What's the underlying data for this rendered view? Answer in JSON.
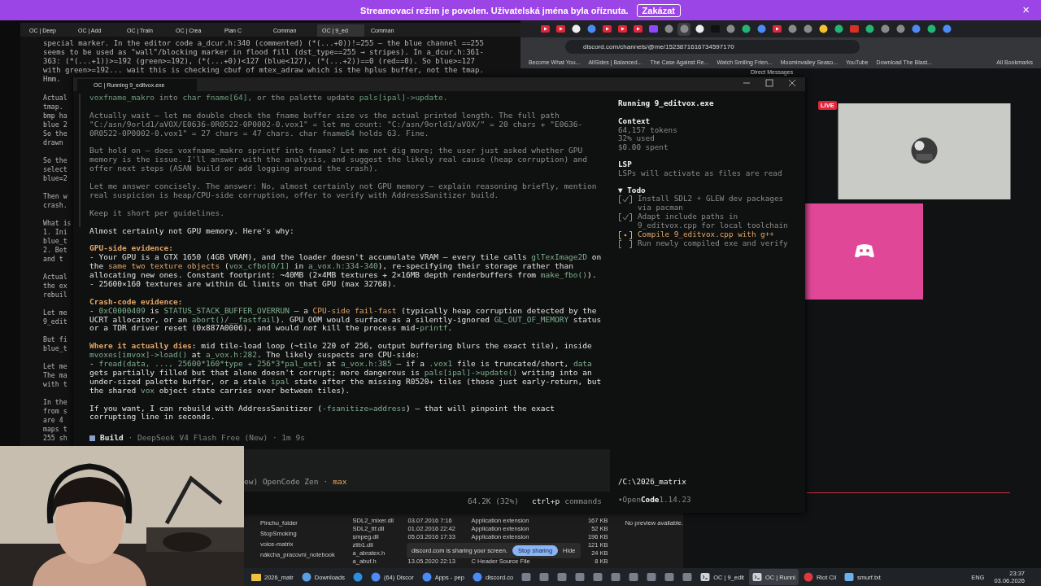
{
  "banner": {
    "text": "Streamovací režim je povolen. Uživatelská jména byla oříznuta.",
    "button": "Zakázat",
    "close": "×"
  },
  "background_terminal": {
    "tabs": [
      {
        "label": "OC | Deep",
        "selected": false
      },
      {
        "label": "OC | Add",
        "selected": false
      },
      {
        "label": "OC | Train",
        "selected": false
      },
      {
        "label": "OC | Crea",
        "selected": false
      },
      {
        "label": "Plan C",
        "selected": false
      },
      {
        "label": "Comman",
        "selected": false
      },
      {
        "label": "OC | 9_ed",
        "selected": true
      },
      {
        "label": "Comman",
        "selected": false
      }
    ],
    "lines": [
      "special marker. In the editor code a_dcur.h:340 (commented) (*(...+0))!=255 — the blue channel ==255",
      "seems to be used as \"wall\"/blocking marker in flood fill (dst_type==255 → stripes). In a_dcur.h:361-",
      "363: (*(...+1))>=192 (green>=192), (*(...+0))<127 (blue<127), (*(...+2))==0 (red==0). So blue>=127",
      "with green>=192... wait this is checking cbuf of mtex_adraw which is the hplus buffer, not the tmap.",
      "Hmm."
    ],
    "fragments": [
      [
        "Actual",
        "tmap.",
        "bmp ha",
        "blue 2",
        "So the",
        "drawn"
      ],
      [
        "So the",
        "select",
        "blue=2"
      ],
      [
        "Then w",
        "crash."
      ],
      [
        "What is",
        "1. Ini",
        "blue_t",
        "2. Bet",
        "and t"
      ],
      [
        "Actual",
        "the ex",
        "rebuil"
      ],
      [
        "Let me",
        "9_edit"
      ],
      [
        "But fi",
        "blue_t"
      ],
      [
        "Let me",
        "The ma",
        "with t"
      ],
      [
        "In the",
        "from s",
        "are 4",
        "maps t",
        "255 sh"
      ]
    ]
  },
  "browser": {
    "tabs": [
      {
        "kind": "video",
        "selected": false
      },
      {
        "kind": "video",
        "selected": false
      },
      {
        "kind": "github",
        "selected": false
      },
      {
        "kind": "chrome",
        "selected": false
      },
      {
        "kind": "video",
        "selected": false
      },
      {
        "kind": "video",
        "selected": false
      },
      {
        "kind": "video",
        "selected": false
      },
      {
        "kind": "twitch",
        "selected": false
      },
      {
        "kind": "generic",
        "selected": false
      },
      {
        "kind": "generic",
        "selected": true
      },
      {
        "kind": "github",
        "selected": false
      },
      {
        "kind": "x",
        "selected": false
      },
      {
        "kind": "generic",
        "selected": false
      },
      {
        "kind": "green",
        "selected": false
      },
      {
        "kind": "chrome",
        "selected": false
      },
      {
        "kind": "video",
        "selected": false
      },
      {
        "kind": "generic",
        "selected": false
      },
      {
        "kind": "generic",
        "selected": false
      },
      {
        "kind": "yellow",
        "selected": false
      },
      {
        "kind": "green",
        "selected": false
      },
      {
        "kind": "mail",
        "selected": false
      },
      {
        "kind": "green",
        "selected": false
      },
      {
        "kind": "generic",
        "selected": false
      },
      {
        "kind": "generic",
        "selected": false
      },
      {
        "kind": "chrome",
        "selected": false
      },
      {
        "kind": "green",
        "selected": false
      },
      {
        "kind": "chrome",
        "selected": false
      }
    ],
    "address": "discord.com/channels/@me/1523871616734597170",
    "bookmarks": [
      "Become What You...",
      "AllSides | Balanced...",
      "The Case Against Re...",
      "Watch Smiling Frien...",
      "Moominvalley Seaso...",
      "YouTube",
      "Download The Blast..."
    ],
    "all_bookmarks": "All Bookmarks",
    "discord": {
      "header": "Direct Messages",
      "live_badge": "LIVE"
    }
  },
  "explorer": {
    "folders": [
      "Pinchu_folder",
      "StopSmoking",
      "voice-matrix",
      "nákcha_pracovni_notebook"
    ],
    "files": [
      {
        "name": "SDL2_mixer.dll",
        "date": "03.07.2016 7:16",
        "type": "Application extension",
        "size": "167 KB"
      },
      {
        "name": "SDL2_ttf.dll",
        "date": "01.02.2016 22:42",
        "type": "Application extension",
        "size": "52 KB"
      },
      {
        "name": "smpeg.dll",
        "date": "05.03.2016 17:33",
        "type": "Application extension",
        "size": "196 KB"
      },
      {
        "name": "zlib1.dll",
        "size": "121 KB"
      },
      {
        "name": "a_abratex.h",
        "size": "24 KB"
      },
      {
        "name": "a_abuf.h",
        "date": "13.05.2020 22:13",
        "type": "C Header Source File",
        "size": "8 KB"
      }
    ],
    "preview": "No preview available.",
    "share_popup": {
      "text": "discord.com is sharing your screen.",
      "stop": "Stop sharing",
      "hide": "Hide"
    }
  },
  "opencode": {
    "tab": "OC | Running 9_editvox.exe",
    "paragraphs": [
      {
        "kind": "thought",
        "lines": [
          [
            {
              "kind": "code",
              "t": "voxfname_makro"
            },
            {
              "kind": "plain",
              "t": " into "
            },
            {
              "kind": "code",
              "t": "char fname[64]"
            },
            {
              "kind": "plain",
              "t": ", or the palette update "
            },
            {
              "kind": "code",
              "t": "pals[ipal]->update"
            },
            {
              "kind": "plain",
              "t": "."
            }
          ]
        ]
      },
      {
        "kind": "thought",
        "lines": [
          [
            {
              "kind": "plain",
              "t": "Actually wait — let me double check the fname buffer size vs the actual printed length. The full path \"C:/asn/9orld1/aVOX/E0636-0R0522-0P0002-0.vox1\" = let me count: \"C:/asn/9orld1/aVOX/\" = 20 chars + \"E0636-0R0522-0P0002-0.vox1\" = 27 chars = 47 chars. char fname"
            },
            {
              "kind": "code",
              "t": "64"
            },
            {
              "kind": "plain",
              "t": " holds 63. Fine."
            }
          ]
        ]
      },
      {
        "kind": "thought",
        "lines": [
          [
            {
              "kind": "plain",
              "t": "But hold on — does voxfname_makro sprintf into fname? Let me not dig more; the user just asked whether GPU memory is the issue. I'll answer with the analysis, and suggest the likely real cause (heap corruption) and offer next steps (ASAN build or add logging around the crash)."
            }
          ]
        ]
      },
      {
        "kind": "thought",
        "lines": [
          [
            {
              "kind": "plain",
              "t": "Let me answer concisely. The answer: No, almost certainly not GPU memory — explain reasoning briefly, mention real suspicion is heap/CPU-side corruption, offer to verify with AddressSanitizer build."
            }
          ]
        ]
      },
      {
        "kind": "thought",
        "lines": [
          [
            {
              "kind": "plain",
              "t": "Keep it short per guidelines."
            }
          ]
        ]
      },
      {
        "kind": "answer",
        "lines": [
          [
            {
              "kind": "plain",
              "t": "Almost certainly not GPU memory. Here's why:"
            }
          ]
        ]
      },
      {
        "kind": "answer",
        "lines": [
          [
            {
              "kind": "heading",
              "t": "GPU-side evidence:"
            }
          ],
          [
            {
              "kind": "plain",
              "t": "- Your GPU is a GTX 1650 (4GB VRAM), and the loader doesn't accumulate VRAM — every tile calls "
            },
            {
              "kind": "code",
              "t": "glTexImage2D"
            },
            {
              "kind": "plain",
              "t": " on the "
            },
            {
              "kind": "accent",
              "t": "same two texture objects"
            },
            {
              "kind": "plain",
              "t": " ("
            },
            {
              "kind": "code",
              "t": "vox_cfbo[0/1]"
            },
            {
              "kind": "plain",
              "t": " in "
            },
            {
              "kind": "code",
              "t": "a_vox.h:334-340"
            },
            {
              "kind": "plain",
              "t": "), re-specifying their storage rather than allocating new ones. Constant footprint: ~40MB (2×4MB textures + 2×16MB depth renderbuffers from "
            },
            {
              "kind": "code",
              "t": "make_fbo()"
            },
            {
              "kind": "plain",
              "t": ")."
            }
          ],
          [
            {
              "kind": "plain",
              "t": "- 25600×160 textures are within GL limits on that GPU (max 32768)."
            }
          ]
        ]
      },
      {
        "kind": "answer",
        "lines": [
          [
            {
              "kind": "heading",
              "t": "Crash-code evidence:"
            }
          ],
          [
            {
              "kind": "plain",
              "t": "- "
            },
            {
              "kind": "code",
              "t": "0xC0000409"
            },
            {
              "kind": "plain",
              "t": " is "
            },
            {
              "kind": "code",
              "t": "STATUS_STACK_BUFFER_OVERRUN"
            },
            {
              "kind": "plain",
              "t": " — a "
            },
            {
              "kind": "accent",
              "t": "CPU-side fail-fast"
            },
            {
              "kind": "plain",
              "t": " (typically heap corruption detected by the UCRT allocator, or an "
            },
            {
              "kind": "code",
              "t": "abort()/__fastfail"
            },
            {
              "kind": "plain",
              "t": "). GPU OOM would surface as a silently-ignored "
            },
            {
              "kind": "code",
              "t": "GL_OUT_OF_MEMORY"
            },
            {
              "kind": "plain",
              "t": " status or a TDR driver reset (0x887A0006), and would "
            },
            {
              "kind": "italic",
              "t": "not"
            },
            {
              "kind": "plain",
              "t": " kill the process mid-"
            },
            {
              "kind": "code",
              "t": "printf"
            },
            {
              "kind": "plain",
              "t": "."
            }
          ]
        ]
      },
      {
        "kind": "answer",
        "lines": [
          [
            {
              "kind": "heading",
              "t": "Where it actually dies:"
            },
            {
              "kind": "plain",
              "t": " mid tile-load loop (~tile 220 of 256, output buffering blurs the exact tile), inside "
            },
            {
              "kind": "code",
              "t": "mvoxes[imvox]->load()"
            },
            {
              "kind": "plain",
              "t": " at "
            },
            {
              "kind": "code",
              "t": "a_vox.h:282"
            },
            {
              "kind": "plain",
              "t": ". The likely suspects are CPU-side:"
            }
          ],
          [
            {
              "kind": "plain",
              "t": "- "
            },
            {
              "kind": "code",
              "t": "fread(data, ..., 25600*160*type + 256*3*pal_ext)"
            },
            {
              "kind": "plain",
              "t": " at "
            },
            {
              "kind": "code",
              "t": "a_vox.h:385"
            },
            {
              "kind": "plain",
              "t": " — if a "
            },
            {
              "kind": "code",
              "t": ".vox1"
            },
            {
              "kind": "plain",
              "t": " file is truncated/short, "
            },
            {
              "kind": "code",
              "t": "data"
            },
            {
              "kind": "plain",
              "t": " gets partially filled but that alone doesn't corrupt; more dangerous is "
            },
            {
              "kind": "code",
              "t": "pals[ipal]->update()"
            },
            {
              "kind": "plain",
              "t": " writing into an under-sized palette buffer, or a stale "
            },
            {
              "kind": "code",
              "t": "ipal"
            },
            {
              "kind": "plain",
              "t": " state after the missing R0520+ tiles (those just early-return, but the shared "
            },
            {
              "kind": "code",
              "t": "vox"
            },
            {
              "kind": "plain",
              "t": " object state carries over between tiles)."
            }
          ]
        ]
      },
      {
        "kind": "answer",
        "lines": [
          [
            {
              "kind": "plain",
              "t": "If you want, I can rebuild with AddressSanitizer ("
            },
            {
              "kind": "code",
              "t": "-fsanitize=address"
            },
            {
              "kind": "plain",
              "t": ") — that will pinpoint the exact corrupting line in seconds."
            }
          ]
        ]
      }
    ],
    "build": {
      "mode": "Build",
      "info": "· DeepSeek V4 Flash Free (New) · 1m 9s"
    },
    "prompt": {
      "model": "ew) OpenCode Zen",
      "sep": "·",
      "variant": "max"
    },
    "status": {
      "usage": "64.2K (32%)",
      "shortcut": "ctrl+p",
      "shortcut_label": "commands"
    },
    "side": {
      "title": "Running 9_editvox.exe",
      "context": {
        "heading": "Context",
        "lines": [
          "64,157 tokens",
          "32% used",
          "$0.00 spent"
        ]
      },
      "lsp": {
        "heading": "LSP",
        "text": "LSPs will activate as files are read"
      },
      "todo": {
        "heading": "▼ Todo",
        "items": [
          {
            "checked": true,
            "text": "Install SDL2 + GLEW dev packages via pacman",
            "kind": "done"
          },
          {
            "checked": true,
            "text": "Adapt include paths in 9_editvox.cpp for local toolchain",
            "kind": "done"
          },
          {
            "checked": false,
            "text": "Compile 9_editvox.cpp with g++",
            "kind": "active"
          },
          {
            "checked": false,
            "text": "Run newly compiled exe and verify",
            "kind": "pending"
          }
        ]
      },
      "path": "/C:\\2026_matrix",
      "version": {
        "dot": "•",
        "open": "Open",
        "code": "Code",
        "number": "1.14.23"
      }
    }
  },
  "taskbar": {
    "items": [
      {
        "kind": "folder",
        "label": "2026_matr",
        "selected": false
      },
      {
        "kind": "download",
        "label": "Downloads",
        "selected": false
      },
      {
        "kind": "code",
        "selected": false
      },
      {
        "kind": "chrome",
        "label": "(64) Discor",
        "selected": false
      },
      {
        "kind": "chrome",
        "label": "Apps - pep",
        "selected": false
      },
      {
        "kind": "chrome",
        "label": "discord.co",
        "selected": false
      },
      {
        "kind": "app",
        "selected": false
      },
      {
        "kind": "app",
        "selected": false
      },
      {
        "kind": "app",
        "selected": false
      },
      {
        "kind": "app",
        "selected": false
      },
      {
        "kind": "app",
        "selected": false
      },
      {
        "kind": "app",
        "selected": false
      },
      {
        "kind": "app",
        "selected": false
      },
      {
        "kind": "app",
        "selected": false
      },
      {
        "kind": "app",
        "selected": false
      },
      {
        "kind": "app",
        "selected": false
      },
      {
        "kind": "terminal",
        "label": "OC | 9_edit",
        "selected": false
      },
      {
        "kind": "terminal",
        "label": "OC | Runni",
        "selected": true
      },
      {
        "kind": "riot",
        "label": "Riot Cli",
        "selected": false
      },
      {
        "kind": "notepad",
        "label": "smurf.txt",
        "selected": false
      }
    ],
    "language": "ENG",
    "time": "23:37",
    "date": "03.06.2026"
  }
}
